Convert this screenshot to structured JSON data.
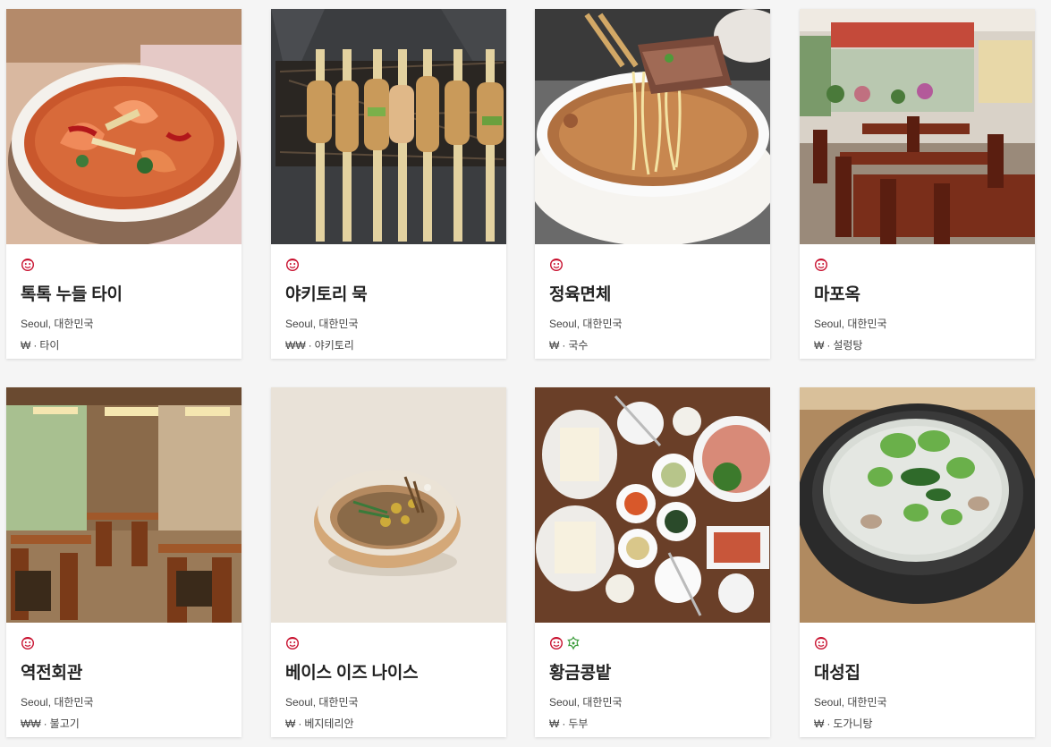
{
  "colors": {
    "michelin_red": "#c8102e",
    "green_star": "#3a9b3a"
  },
  "restaurants": [
    {
      "name": "톡톡 누들 타이",
      "location": "Seoul, 대한민국",
      "price": "₩",
      "cuisine": "타이",
      "distinctions": [
        "bib-gourmand-icon"
      ],
      "photo": "tom-yum-noodle-bowl"
    },
    {
      "name": "야키토리 묵",
      "location": "Seoul, 대한민국",
      "price": "₩₩",
      "cuisine": "야키토리",
      "distinctions": [
        "bib-gourmand-icon"
      ],
      "photo": "yakitori-skewers"
    },
    {
      "name": "정육면체",
      "location": "Seoul, 대한민국",
      "price": "₩",
      "cuisine": "국수",
      "distinctions": [
        "bib-gourmand-icon"
      ],
      "photo": "beef-noodle-soup"
    },
    {
      "name": "마포옥",
      "location": "Seoul, 대한민국",
      "price": "₩",
      "cuisine": "설렁탕",
      "distinctions": [
        "bib-gourmand-icon"
      ],
      "photo": "restaurant-interior"
    },
    {
      "name": "역전회관",
      "location": "Seoul, 대한민국",
      "price": "₩₩",
      "cuisine": "불고기",
      "distinctions": [
        "bib-gourmand-icon"
      ],
      "photo": "dining-room"
    },
    {
      "name": "베이스 이즈 나이스",
      "location": "Seoul, 대한민국",
      "price": "₩",
      "cuisine": "베지테리안",
      "distinctions": [
        "bib-gourmand-icon"
      ],
      "photo": "grain-bowl"
    },
    {
      "name": "황금콩밭",
      "location": "Seoul, 대한민국",
      "price": "₩",
      "cuisine": "두부",
      "distinctions": [
        "bib-gourmand-icon",
        "green-star-icon"
      ],
      "photo": "tofu-spread"
    },
    {
      "name": "대성집",
      "location": "Seoul, 대한민국",
      "price": "₩",
      "cuisine": "도가니탕",
      "distinctions": [
        "bib-gourmand-icon"
      ],
      "photo": "stone-pot-soup"
    }
  ]
}
